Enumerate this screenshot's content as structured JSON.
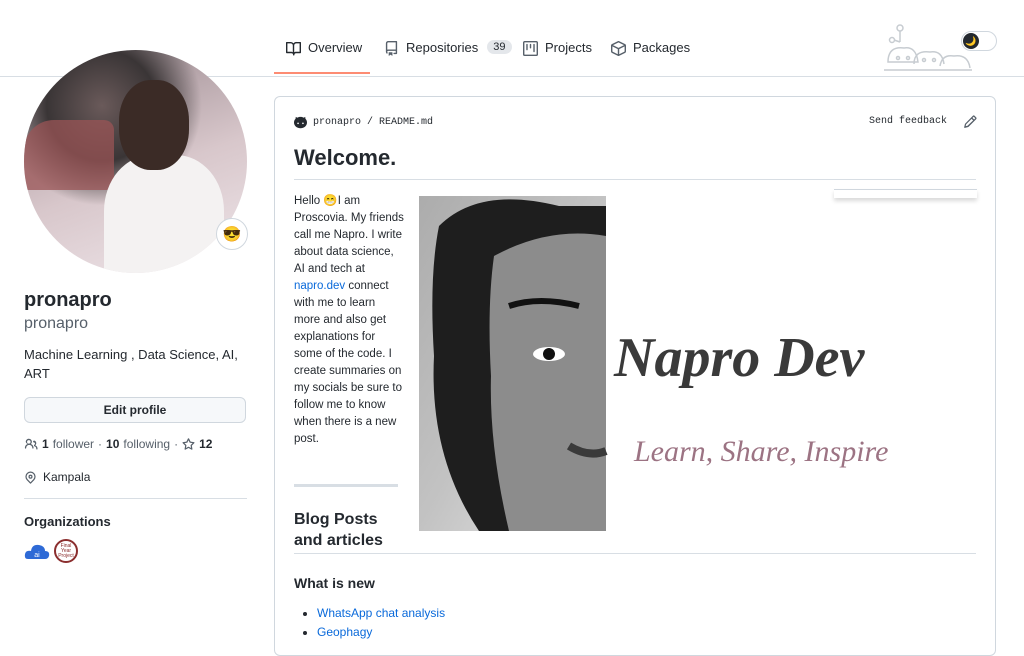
{
  "nav": {
    "tabs": [
      {
        "label": "Overview",
        "icon": "book-icon",
        "active": true
      },
      {
        "label": "Repositories",
        "icon": "repo-icon",
        "count": "39"
      },
      {
        "label": "Projects",
        "icon": "project-icon"
      },
      {
        "label": "Packages",
        "icon": "package-icon"
      }
    ]
  },
  "profile": {
    "status_emoji": "😎",
    "name": "pronapro",
    "login": "pronapro",
    "bio": "Machine Learning , Data Science, AI, ART",
    "edit_label": "Edit profile",
    "followers_count": "1",
    "followers_label": "follower",
    "sep": "·",
    "following_count": "10",
    "following_label": "following",
    "sep2": "·",
    "stars_count": "12",
    "location": "Kampala",
    "organizations_title": "Organizations",
    "org1_text": "ai",
    "org2_text": "Final Year Project"
  },
  "readme": {
    "path_owner": "pronapro",
    "path_sep": "/",
    "path_file": "README.md",
    "send_feedback": "Send feedback",
    "heading": "Welcome.",
    "intro_before": "Hello 😁I am Proscovia. My friends call me Napro. I write about data science, AI and tech at ",
    "intro_link": "napro.dev",
    "intro_after": " connect with me to learn more and also get explanations for some of the code. I create summaries on my socials be sure to follow me to know when there is a new post.",
    "banner_title": "Napro Dev",
    "banner_tagline": "Learn, Share, Inspire",
    "blog_title": "Blog Posts and articles",
    "whats_new": "What is new",
    "posts": [
      "WhatsApp chat analysis",
      "Geophagy"
    ]
  },
  "theme_toggle_icon": "🌙",
  "colors": {
    "accent": "#fd8c73",
    "link": "#0969da",
    "banner_title": "#3a3a3a",
    "banner_tagline": "#9c7383"
  }
}
